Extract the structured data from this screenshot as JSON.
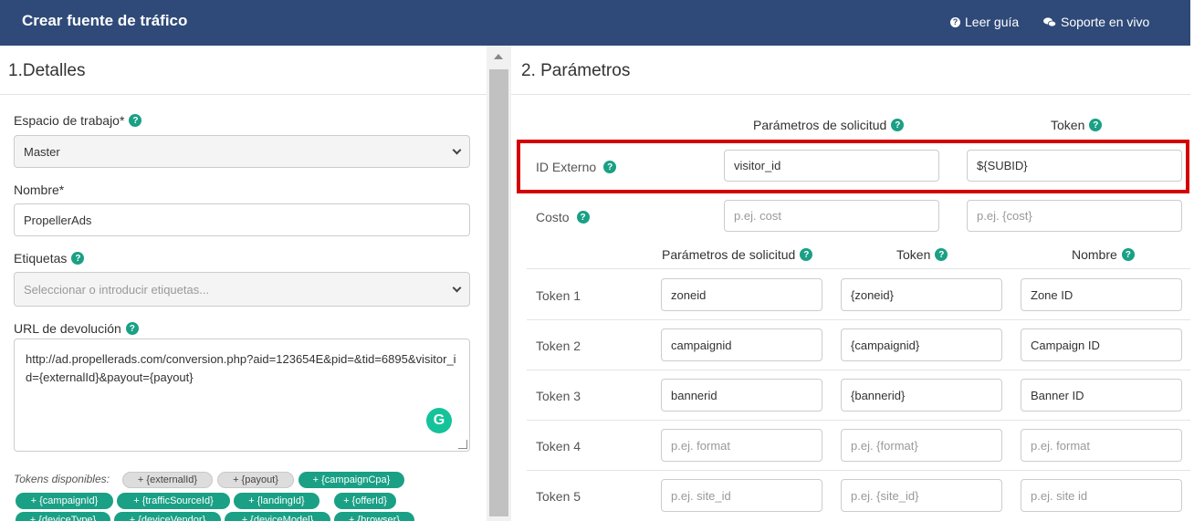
{
  "header": {
    "title": "Crear fuente de tráfico",
    "guide_label": "Leer guía",
    "support_label": "Soporte en vivo"
  },
  "details": {
    "section_title": "1.Detalles",
    "workspace_label": "Espacio de trabajo*",
    "workspace_value": "Master",
    "name_label": "Nombre*",
    "name_value": "PropellerAds",
    "tags_label": "Etiquetas",
    "tags_placeholder": "Seleccionar o introducir etiquetas...",
    "postback_label": "URL de devolución",
    "postback_value": "http://ad.propellerads.com/conversion.php?aid=123654E&pid=&tid=6895&visitor_id={externalId}&payout={payout}",
    "tokens_label": "Tokens disponibles:",
    "tokens": [
      {
        "label": "+ {externalId}",
        "style": "gray"
      },
      {
        "label": "+ {payout}",
        "style": "gray"
      },
      {
        "label": "+ {campaignCpa}",
        "style": "green"
      },
      {
        "label": "+ {campaignId}",
        "style": "green"
      },
      {
        "label": "+ {trafficSourceId}",
        "style": "green"
      },
      {
        "label": "+ {landingId}",
        "style": "green"
      },
      {
        "label": "+ {offerId}",
        "style": "green"
      },
      {
        "label": "+ {deviceType}",
        "style": "green"
      },
      {
        "label": "+ {deviceVendor}",
        "style": "green"
      },
      {
        "label": "+ {deviceModel}",
        "style": "green"
      },
      {
        "label": "+ {browser}",
        "style": "green"
      }
    ]
  },
  "params": {
    "section_title": "2. Parámetros",
    "top_headers": {
      "request": "Parámetros de solicitud",
      "token": "Token"
    },
    "external_id": {
      "label": "ID Externo",
      "param": "visitor_id",
      "token": "${SUBID}"
    },
    "cost": {
      "label": "Costo",
      "param_placeholder": "p.ej. cost",
      "token_placeholder": "p.ej. {cost}"
    },
    "token_headers": {
      "request": "Parámetros de solicitud",
      "token": "Token",
      "name": "Nombre"
    },
    "token_rows": [
      {
        "label": "Token 1",
        "param": "zoneid",
        "token": "{zoneid}",
        "name": "Zone ID",
        "placeholder": false
      },
      {
        "label": "Token 2",
        "param": "campaignid",
        "token": "{campaignid}",
        "name": "Campaign ID",
        "placeholder": false
      },
      {
        "label": "Token 3",
        "param": "bannerid",
        "token": "{bannerid}",
        "name": "Banner ID",
        "placeholder": false
      },
      {
        "label": "Token 4",
        "param": "p.ej. format",
        "token": "p.ej. {format}",
        "name": "p.ej. format",
        "placeholder": true
      },
      {
        "label": "Token 5",
        "param": "p.ej. site_id",
        "token": "p.ej. {site_id}",
        "name": "p.ej. site id",
        "placeholder": true
      }
    ]
  }
}
